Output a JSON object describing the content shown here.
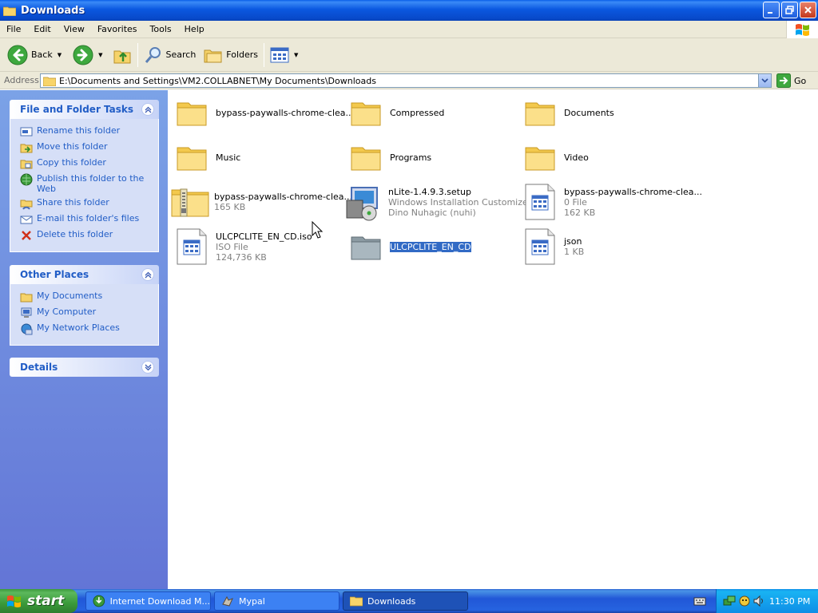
{
  "window": {
    "title": "Downloads"
  },
  "menu": [
    "File",
    "Edit",
    "View",
    "Favorites",
    "Tools",
    "Help"
  ],
  "toolbar": {
    "back": "Back",
    "search": "Search",
    "folders": "Folders"
  },
  "address": {
    "label": "Address",
    "path": "E:\\Documents and Settings\\VM2.COLLABNET\\My Documents\\Downloads",
    "go": "Go"
  },
  "tasks_panel": {
    "title": "File and Folder Tasks",
    "items": [
      {
        "label": "Rename this folder",
        "icon": "rename-icon"
      },
      {
        "label": "Move this folder",
        "icon": "move-icon"
      },
      {
        "label": "Copy this folder",
        "icon": "copy-icon"
      },
      {
        "label": "Publish this folder to the Web",
        "icon": "globe-icon"
      },
      {
        "label": "Share this folder",
        "icon": "share-icon"
      },
      {
        "label": "E-mail this folder's files",
        "icon": "email-icon"
      },
      {
        "label": "Delete this folder",
        "icon": "delete-icon"
      }
    ]
  },
  "places_panel": {
    "title": "Other Places",
    "items": [
      {
        "label": "My Documents",
        "icon": "folder-icon"
      },
      {
        "label": "My Computer",
        "icon": "computer-icon"
      },
      {
        "label": "My Network Places",
        "icon": "network-icon"
      }
    ]
  },
  "details_panel": {
    "title": "Details"
  },
  "files": [
    {
      "name": "bypass-paywalls-chrome-clea...",
      "type": "folder"
    },
    {
      "name": "Compressed",
      "type": "folder"
    },
    {
      "name": "Documents",
      "type": "folder"
    },
    {
      "name": "Music",
      "type": "folder"
    },
    {
      "name": "Programs",
      "type": "folder"
    },
    {
      "name": "Video",
      "type": "folder"
    },
    {
      "name": "bypass-paywalls-chrome-clea...",
      "sub1": "165 KB",
      "type": "zip"
    },
    {
      "name": "nLite-1.4.9.3.setup",
      "sub1": "Windows Installation Customizer",
      "sub2": "Dino Nuhagic (nuhi)",
      "type": "setup"
    },
    {
      "name": "bypass-paywalls-chrome-clea...",
      "sub1": "0 File",
      "sub2": "162 KB",
      "type": "file"
    },
    {
      "name": "ULCPCLITE_EN_CD.iso",
      "sub1": "ISO File",
      "sub2": "124,736 KB",
      "type": "file"
    },
    {
      "name": "ULCPCLITE_EN_CD",
      "type": "folder-gray",
      "selected": true
    },
    {
      "name": "json",
      "sub1": "1 KB",
      "type": "file"
    }
  ],
  "taskbar": {
    "start": "start",
    "buttons": [
      {
        "label": "Internet Download M...",
        "icon": "idm-icon"
      },
      {
        "label": "Mypal",
        "icon": "mypal-icon"
      },
      {
        "label": "Downloads",
        "icon": "folder-icon",
        "active": true
      }
    ],
    "clock": "11:30 PM"
  }
}
